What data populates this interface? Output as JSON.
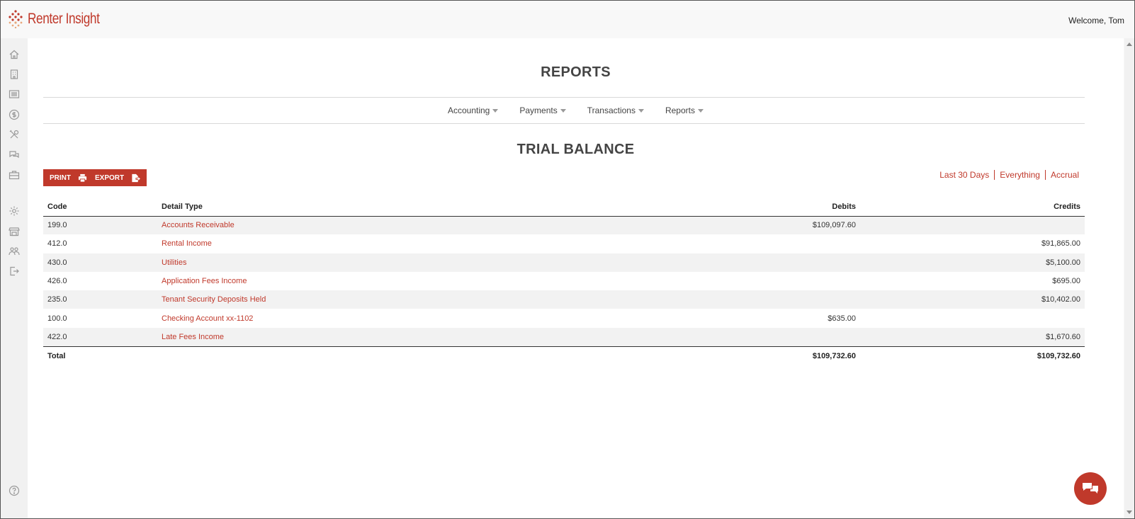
{
  "app": {
    "name": "Renter Insight",
    "welcome": "Welcome, Tom"
  },
  "sidebar": {
    "items": [
      {
        "icon": "home-icon"
      },
      {
        "icon": "building-icon"
      },
      {
        "icon": "list-icon"
      },
      {
        "icon": "dollar-icon"
      },
      {
        "icon": "tools-icon"
      },
      {
        "icon": "chat-icon"
      },
      {
        "icon": "briefcase-icon"
      },
      {
        "icon": "gear-icon"
      },
      {
        "icon": "store-icon"
      },
      {
        "icon": "users-icon"
      },
      {
        "icon": "logout-icon"
      }
    ],
    "help_icon": "help-icon"
  },
  "page": {
    "title": "REPORTS",
    "nav": [
      {
        "label": "Accounting"
      },
      {
        "label": "Payments"
      },
      {
        "label": "Transactions"
      },
      {
        "label": "Reports"
      }
    ],
    "report_title": "TRIAL BALANCE",
    "buttons": {
      "print_label": "PRINT",
      "export_label": "EXPORT"
    },
    "filters": [
      "Last 30 Days",
      "Everything",
      "Accrual"
    ]
  },
  "table": {
    "headers": {
      "code": "Code",
      "detail": "Detail Type",
      "debits": "Debits",
      "credits": "Credits"
    },
    "rows": [
      {
        "code": "199.0",
        "detail": "Accounts Receivable",
        "debits": "$109,097.60",
        "credits": ""
      },
      {
        "code": "412.0",
        "detail": "Rental Income",
        "debits": "",
        "credits": "$91,865.00"
      },
      {
        "code": "430.0",
        "detail": "Utilities",
        "debits": "",
        "credits": "$5,100.00"
      },
      {
        "code": "426.0",
        "detail": "Application Fees Income",
        "debits": "",
        "credits": "$695.00"
      },
      {
        "code": "235.0",
        "detail": "Tenant Security Deposits Held",
        "debits": "",
        "credits": "$10,402.00"
      },
      {
        "code": "100.0",
        "detail": "Checking Account xx-1102",
        "debits": "$635.00",
        "credits": ""
      },
      {
        "code": "422.0",
        "detail": "Late Fees Income",
        "debits": "",
        "credits": "$1,670.60"
      }
    ],
    "total": {
      "label": "Total",
      "debits": "$109,732.60",
      "credits": "$109,732.60"
    }
  },
  "colors": {
    "accent": "#c0392b",
    "row_stripe": "#f2f2f2"
  }
}
